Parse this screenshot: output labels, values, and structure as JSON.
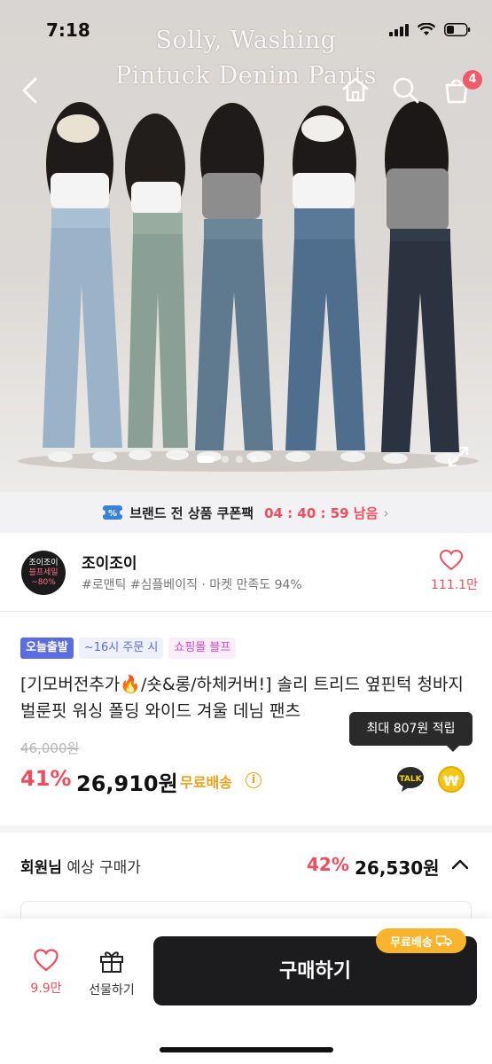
{
  "status_bar": {
    "time": "7:18"
  },
  "hero": {
    "caption_line1": "Solly, Washing",
    "caption_line2": "Pintuck Denim Pants",
    "cart_count": "4",
    "slide_count": 4,
    "active_slide": 0,
    "icons": [
      "back-icon",
      "home-icon",
      "search-icon",
      "cart-icon",
      "expand-icon"
    ]
  },
  "coupon_banner": {
    "text": "브랜드 전 상품 쿠폰팩",
    "timer": "04 : 40 : 59 남음",
    "icon": "coupon-ticket-icon"
  },
  "store": {
    "logo_line1": "조이조이",
    "logo_line2": "블프세일",
    "logo_line3": "~80%",
    "name": "조이조이",
    "tags": "#로맨틱 #심플베이직 · 마켓 만족도 94%",
    "like_count": "111.1만"
  },
  "product": {
    "badges": [
      "오늘출발",
      "~16시 주문 시",
      "쇼핑몰 블프"
    ],
    "title": "[기모버전추가🔥/숏&롱/하체커버!] 솔리 트리드 옆핀턱 청바지 벌룬핏 워싱 폴딩 와이드 겨울 데님 팬츠",
    "tooltip": "최대 807원 적립",
    "original_price": "46,000원",
    "discount": "41%",
    "price": "26,910원",
    "shipping": "무료배송",
    "talk_label": "TALK",
    "won_symbol": "₩"
  },
  "member_price": {
    "label_bold": "회원님",
    "label_rest": " 예상 구매가",
    "discount": "42%",
    "price": "26,530원"
  },
  "bottom_bar": {
    "wish_count": "9.9만",
    "gift_label": "선물하기",
    "buy_label": "구매하기",
    "ship_pill": "무료배송"
  },
  "colors": {
    "accent_red": "#ef4d5d",
    "shipping_yellow": "#e8a21c",
    "button_dark": "#1c1c1e",
    "badge_blue": "#5a6cdf"
  }
}
